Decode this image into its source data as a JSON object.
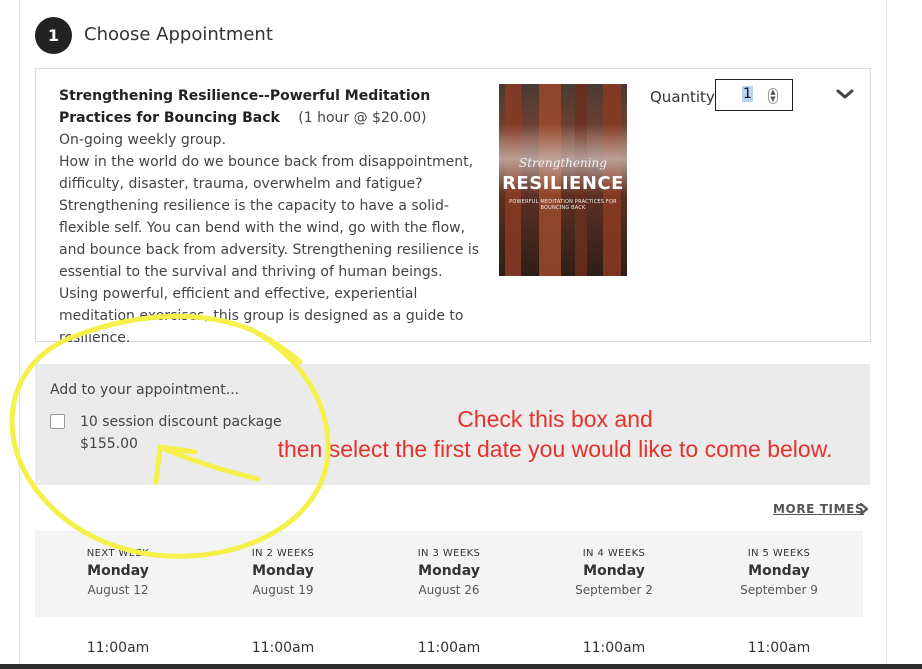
{
  "step": {
    "number": "1",
    "title": "Choose Appointment"
  },
  "appointment": {
    "title": "Strengthening Resilience--Powerful Meditation Practices for Bouncing Back",
    "duration_price": "(1 hour @ $20.00)",
    "description": [
      "On-going weekly group.",
      "How in the world do we bounce back from disappointment, difficulty, disaster, trauma, overwhelm and fatigue?",
      "Strengthening resilience is the capacity to have a solid-flexible self. You can bend with the wind, go with the flow, and bounce back from adversity. Strengthening resilience is essential to the survival and thriving of human beings.",
      "Using powerful, efficient and effective, experiential meditation exercises, this group is designed as a guide to resilience."
    ],
    "image": {
      "script": "Strengthening",
      "title": "RESILIENCE",
      "subtitle": "POWERFUL MEDITATION PRACTICES FOR BOUNCING BACK"
    },
    "quantity_label": "Quantity:",
    "quantity_value": "1",
    "expand_icon": "chevron-down-icon"
  },
  "addon": {
    "heading": "Add to your appointment...",
    "item_name": "10 session discount package",
    "item_price": "$155.00",
    "checked": false
  },
  "annotation": {
    "line1": "Check this box and",
    "line2": "then select the first date you would like to come below.",
    "color": "#e5322d",
    "circle_color": "#f5f04a"
  },
  "more_times": "MORE TIMES",
  "weeks": [
    {
      "relative": "NEXT WEEK",
      "day": "Monday",
      "date": "August 12",
      "time": "11:00am"
    },
    {
      "relative": "IN 2 WEEKS",
      "day": "Monday",
      "date": "August 19",
      "time": "11:00am"
    },
    {
      "relative": "IN 3 WEEKS",
      "day": "Monday",
      "date": "August 26",
      "time": "11:00am"
    },
    {
      "relative": "IN 4 WEEKS",
      "day": "Monday",
      "date": "September 2",
      "time": "11:00am"
    },
    {
      "relative": "IN 5 WEEKS",
      "day": "Monday",
      "date": "September 9",
      "time": "11:00am"
    }
  ]
}
